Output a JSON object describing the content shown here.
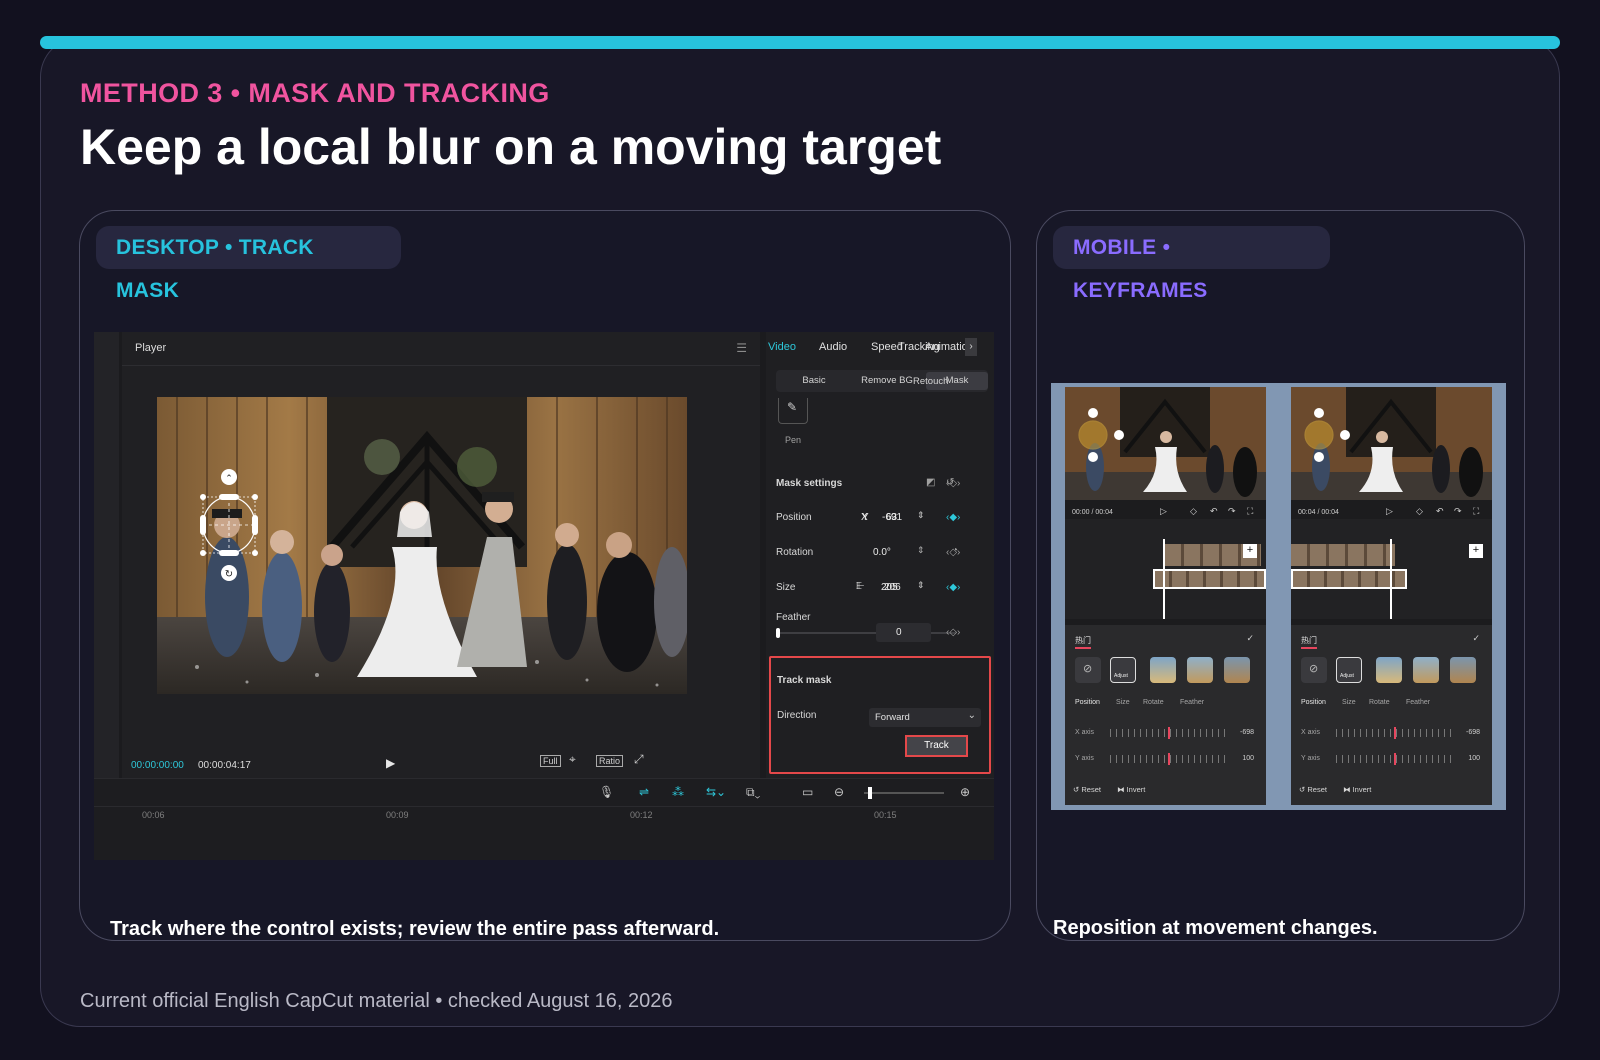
{
  "header": {
    "eyebrow": "METHOD 3 • MASK AND TRACKING",
    "title": "Keep a local blur on a moving target"
  },
  "colors": {
    "accent_cyan": "#27c3dd",
    "accent_pink": "#f0549f",
    "accent_purple": "#8a6cff",
    "highlight_red": "#e4484a"
  },
  "desktop": {
    "chip": "DESKTOP • TRACK MASK",
    "caption": "Track where the control exists; review the entire pass afterward.",
    "player": {
      "title": "Player",
      "timecode_current": "00:00:00:00",
      "timecode_total": "00:00:04:17",
      "controls": [
        "Full",
        "Ratio"
      ]
    },
    "tabs": [
      "Video",
      "Audio",
      "Speed",
      "Animation",
      "Tracking"
    ],
    "subtabs": [
      "Basic",
      "Remove BG",
      "Mask",
      "Retouch"
    ],
    "pen_label": "Pen",
    "mask_settings": {
      "heading": "Mask settings",
      "position_label": "Position",
      "x_label": "X",
      "x_value": "-691",
      "y_label": "Y",
      "y_value": "63",
      "rotation_label": "Rotation",
      "rotation_value": "0.0°",
      "size_label": "Size",
      "width_value": "205",
      "height_value": "206",
      "feather_label": "Feather",
      "feather_value": "0"
    },
    "track_mask": {
      "heading": "Track mask",
      "direction_label": "Direction",
      "direction_value": "Forward",
      "button": "Track"
    },
    "timeline_ticks": [
      "00:06",
      "00:09",
      "00:12",
      "00:15"
    ]
  },
  "mobile": {
    "chip": "MOBILE • KEYFRAMES",
    "caption": "Reposition at movement changes.",
    "phones": [
      {
        "time": "00:00 / 00:04",
        "x_value": "-698",
        "y_value": "100"
      },
      {
        "time": "00:04 / 00:04",
        "x_value": "-698",
        "y_value": "100"
      }
    ],
    "section": "热门",
    "adjust_label": "Adjust",
    "props": [
      "Position",
      "Size",
      "Rotate",
      "Feather"
    ],
    "x_axis": "X axis",
    "y_axis": "Y axis",
    "reset": "Reset",
    "invert": "Invert"
  },
  "footer": "Current official English CapCut material • checked August 16, 2026"
}
